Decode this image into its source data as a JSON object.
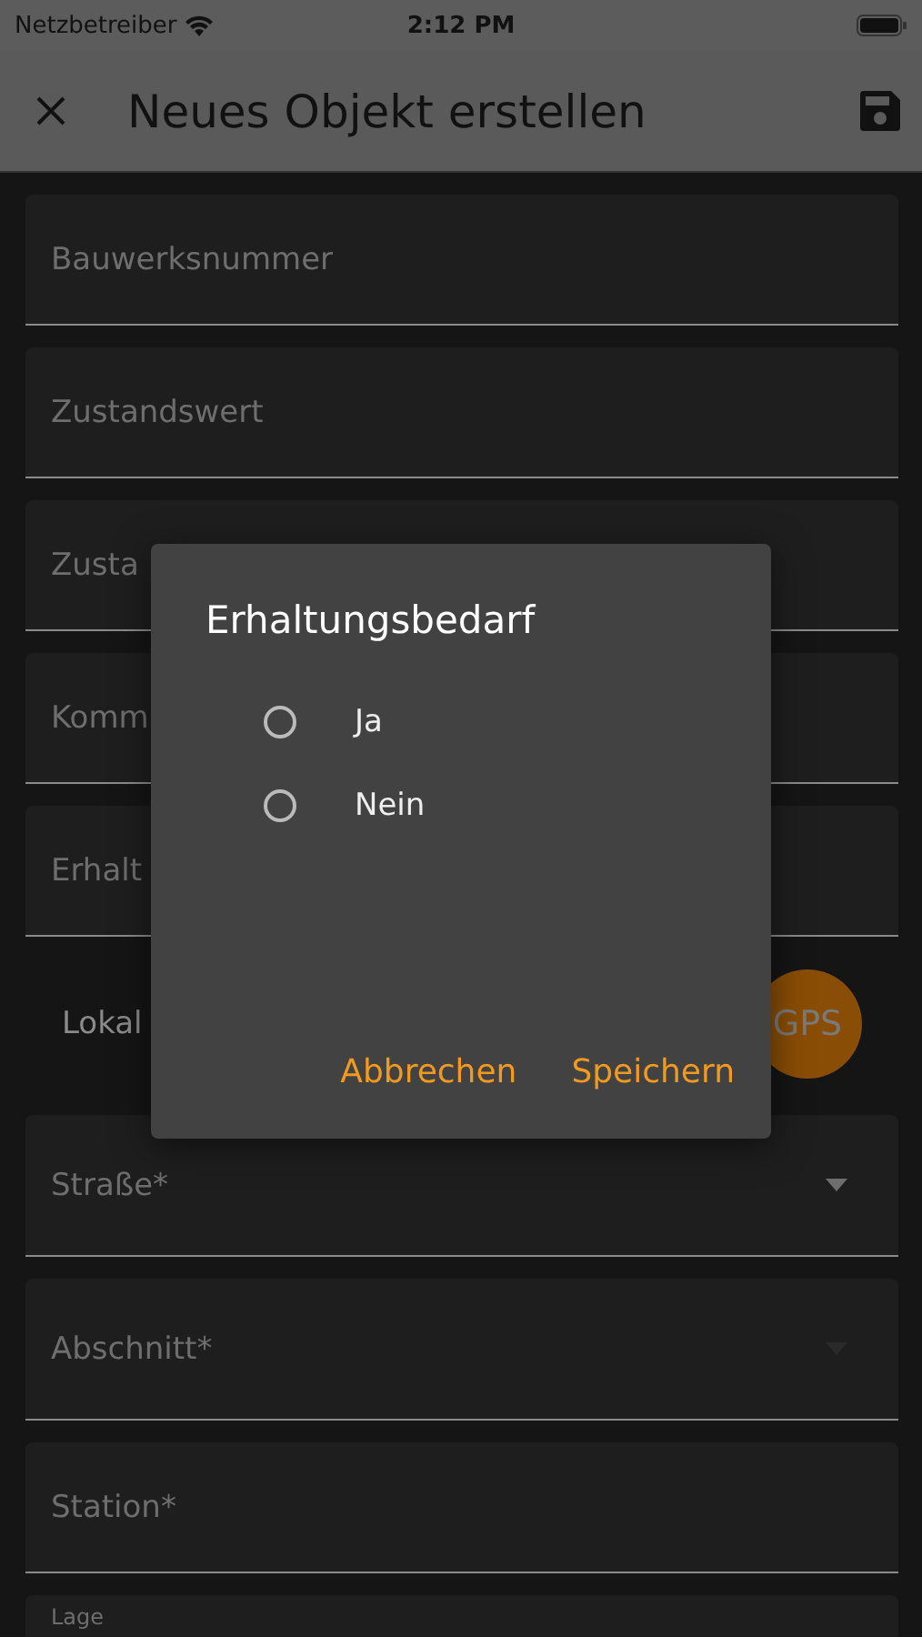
{
  "status_bar": {
    "carrier": "Netzbetreiber",
    "time": "2:12 PM"
  },
  "app_bar": {
    "title": "Neues Objekt erstellen"
  },
  "fields": [
    {
      "kind": "text",
      "placeholder": "Bauwerksnummer"
    },
    {
      "kind": "text",
      "placeholder": "Zustandswert"
    },
    {
      "kind": "text",
      "placeholder": "Zusta"
    },
    {
      "kind": "text",
      "placeholder": "Komm"
    },
    {
      "kind": "text",
      "placeholder": "Erhalt"
    },
    {
      "kind": "location",
      "label": "Lokal",
      "button": "GPS"
    },
    {
      "kind": "dropdown",
      "placeholder": "Straße*",
      "disabled": false
    },
    {
      "kind": "dropdown",
      "placeholder": "Abschnitt*",
      "disabled": true
    },
    {
      "kind": "text",
      "placeholder": "Station*"
    },
    {
      "kind": "caption",
      "label": "Lage"
    }
  ],
  "dialog": {
    "title": "Erhaltungsbedarf",
    "options": [
      {
        "label": "Ja",
        "selected": false
      },
      {
        "label": "Nein",
        "selected": false
      }
    ],
    "buttons": [
      "Abbrechen",
      "Speichern"
    ]
  }
}
